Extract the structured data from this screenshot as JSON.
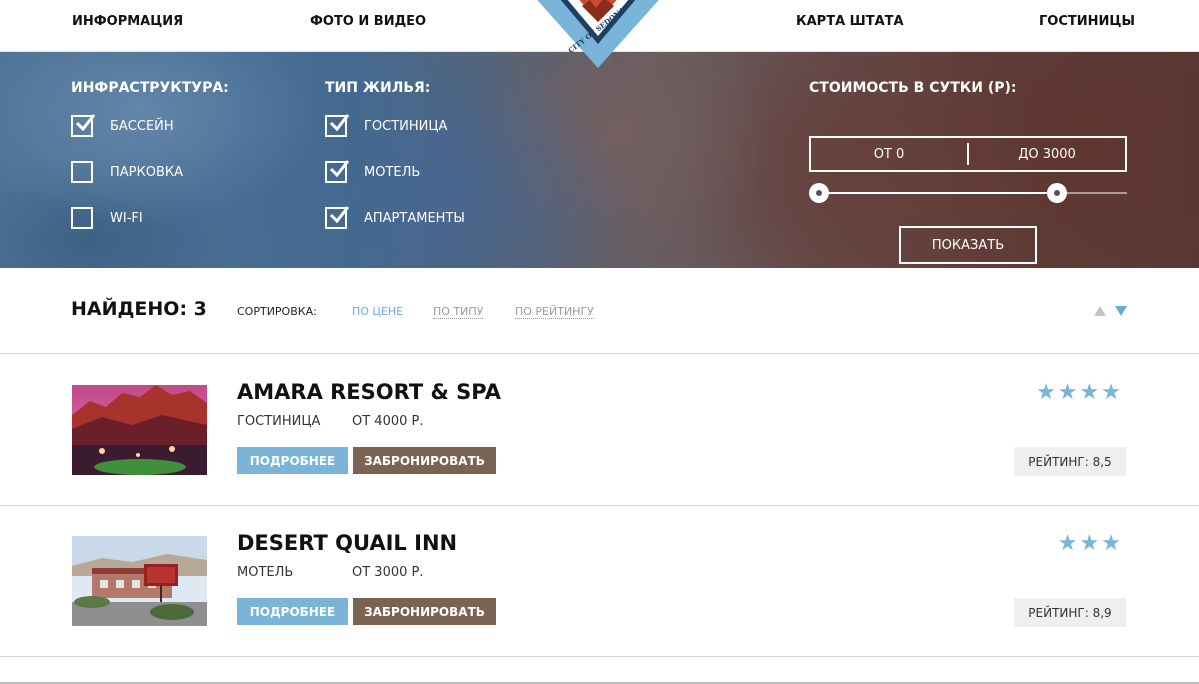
{
  "nav": {
    "items": [
      "ИНФОРМАЦИЯ",
      "ФОТО И ВИДЕО",
      "КАРТА ШТАТА",
      "ГОСТИНИЦЫ"
    ],
    "logo_text": "CITY OF SEDONA"
  },
  "filters": {
    "infrastructure": {
      "title": "ИНФРАСТРУКТУРА:",
      "options": [
        {
          "label": "БАССЕЙН",
          "checked": true
        },
        {
          "label": "ПАРКОВКА",
          "checked": false
        },
        {
          "label": "WI-FI",
          "checked": false
        }
      ]
    },
    "housing": {
      "title": "ТИП ЖИЛЬЯ:",
      "options": [
        {
          "label": "ГОСТИНИЦА",
          "checked": true
        },
        {
          "label": "МОТЕЛЬ",
          "checked": true
        },
        {
          "label": "АПАРТАМЕНТЫ",
          "checked": true
        }
      ]
    },
    "price": {
      "title": "СТОИМОСТЬ В СУТКИ (Р):",
      "from_label": "ОТ 0",
      "to_label": "ДО 3000",
      "range_min_fraction": 0.0,
      "range_max_fraction": 0.8
    },
    "show_button": "ПОКАЗАТЬ"
  },
  "results": {
    "found_label": "НАЙДЕНО: 3",
    "sort_label": "СОРТИРОВКА:",
    "sort_options": [
      {
        "label": "ПО ЦЕНЕ",
        "active": true
      },
      {
        "label": "ПО ТИПУ",
        "active": false
      },
      {
        "label": "ПО РЕЙТИНГУ",
        "active": false
      }
    ],
    "sort_direction": "descending"
  },
  "hotels": [
    {
      "name": "AMARA RESORT & SPA",
      "type": "ГОСТИНИЦА",
      "price": "ОТ 4000 Р.",
      "stars": 4,
      "rating": "РЕЙТИНГ: 8,5",
      "more_label": "ПОДРОБНЕЕ",
      "book_label": "ЗАБРОНИРОВАТЬ"
    },
    {
      "name": "DESERT QUAIL INN",
      "type": "МОТЕЛЬ",
      "price": "ОТ 3000 Р.",
      "stars": 3,
      "rating": "РЕЙТИНГ: 8,9",
      "more_label": "ПОДРОБНЕЕ",
      "book_label": "ЗАБРОНИРОВАТЬ"
    }
  ],
  "colors": {
    "accent_blue": "#7ab4d8",
    "book_brown": "#7a6353",
    "rating_bg": "#efefef"
  }
}
